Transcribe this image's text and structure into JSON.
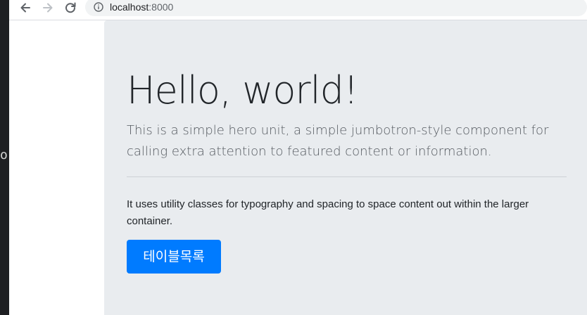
{
  "editor": {
    "edge_glyph": "o."
  },
  "browser": {
    "icons": {
      "back": "arrow-left-icon",
      "forward": "arrow-right-icon",
      "reload": "reload-icon",
      "site_info": "info-icon"
    },
    "address": {
      "host": "localhost",
      "port": ":8000"
    }
  },
  "jumbotron": {
    "title": "Hello, world!",
    "lead": "This is a simple hero unit, a simple jumbotron-style component for calling extra attention to featured content or information.",
    "body": "It uses utility classes for typography and spacing to space content out within the larger container.",
    "button_label": "테이블목록"
  },
  "colors": {
    "jumbotron_bg": "#e9ecef",
    "primary": "#007bff",
    "editor_bg": "#1e1f22"
  }
}
